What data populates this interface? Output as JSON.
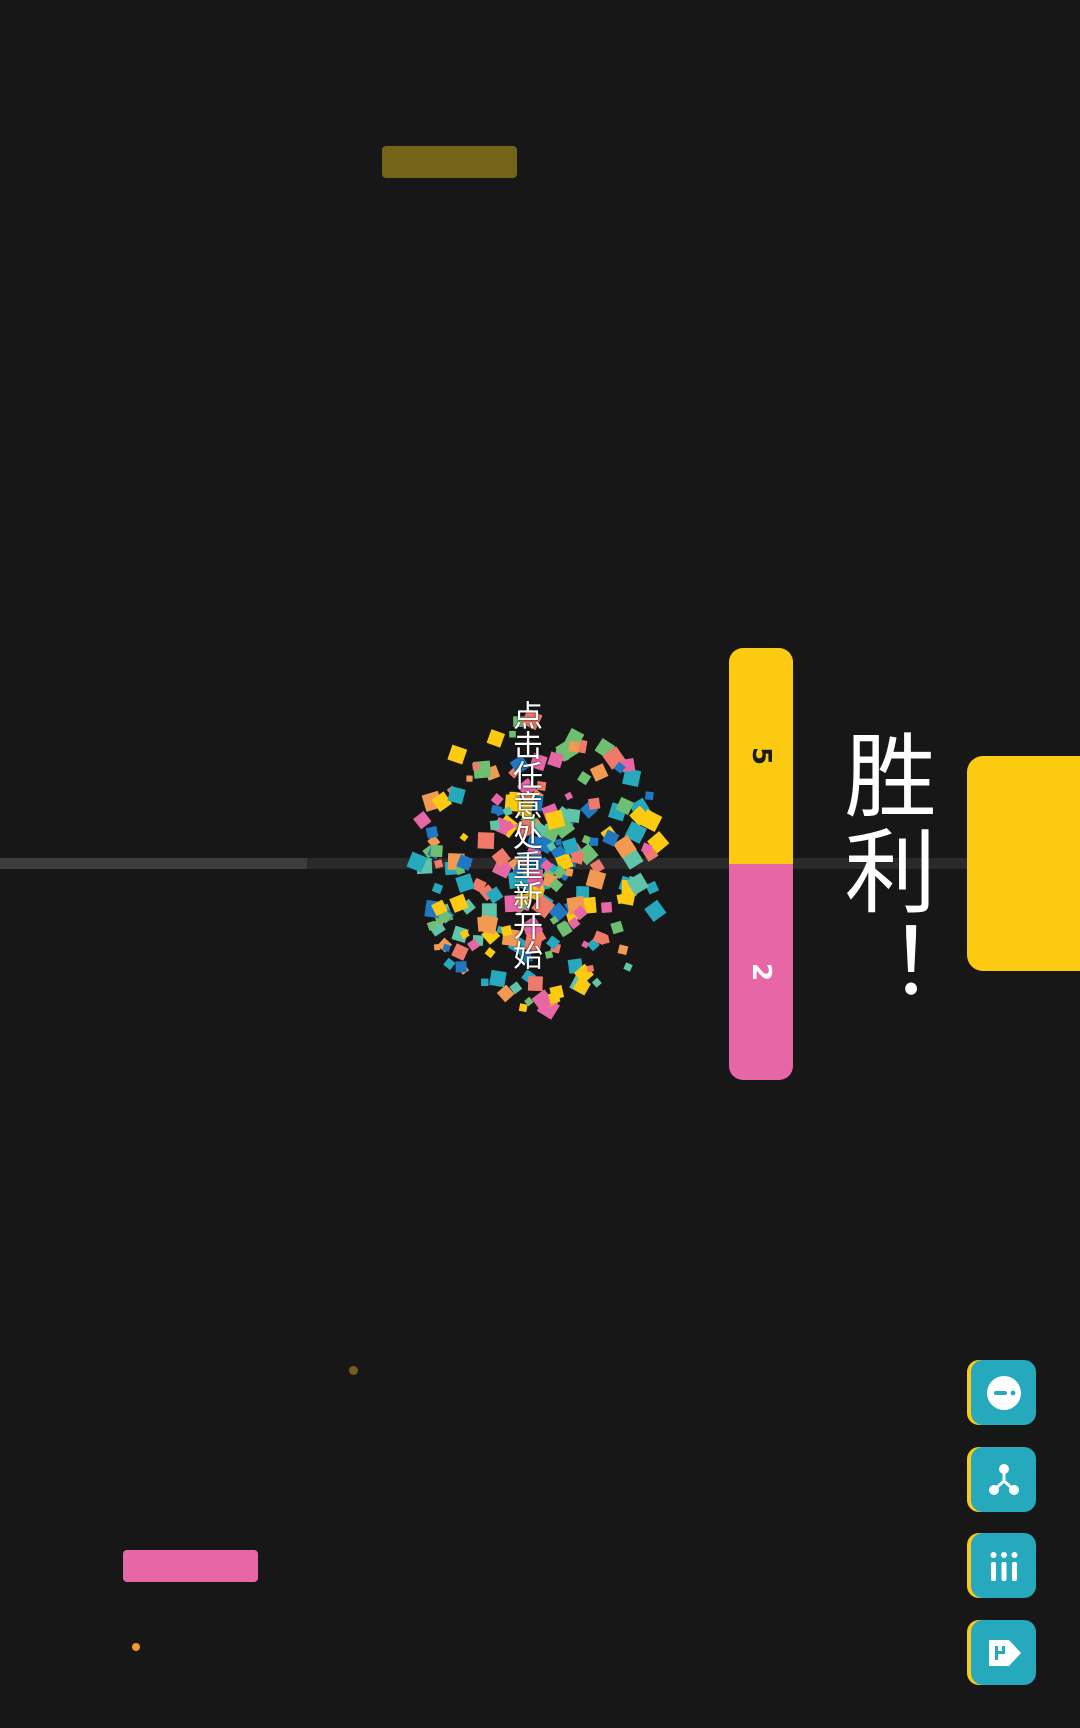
{
  "game": {
    "victory_text": "胜利！",
    "restart_hint": "点击任意处重新开始",
    "score": {
      "top_player": "5",
      "bottom_player": "2"
    },
    "progress_fraction": 0.284
  },
  "colors": {
    "background": "#171717",
    "yellow": "#fcca11",
    "pink": "#e766a5",
    "teal": "#26a9bd",
    "olive_paddle": "#73641a"
  },
  "menu": {
    "buttons": [
      {
        "name": "info",
        "icon": "info-icon"
      },
      {
        "name": "share",
        "icon": "share-icon"
      },
      {
        "name": "stats",
        "icon": "bar-stats-icon"
      },
      {
        "name": "exit",
        "icon": "exit-icon"
      }
    ]
  }
}
